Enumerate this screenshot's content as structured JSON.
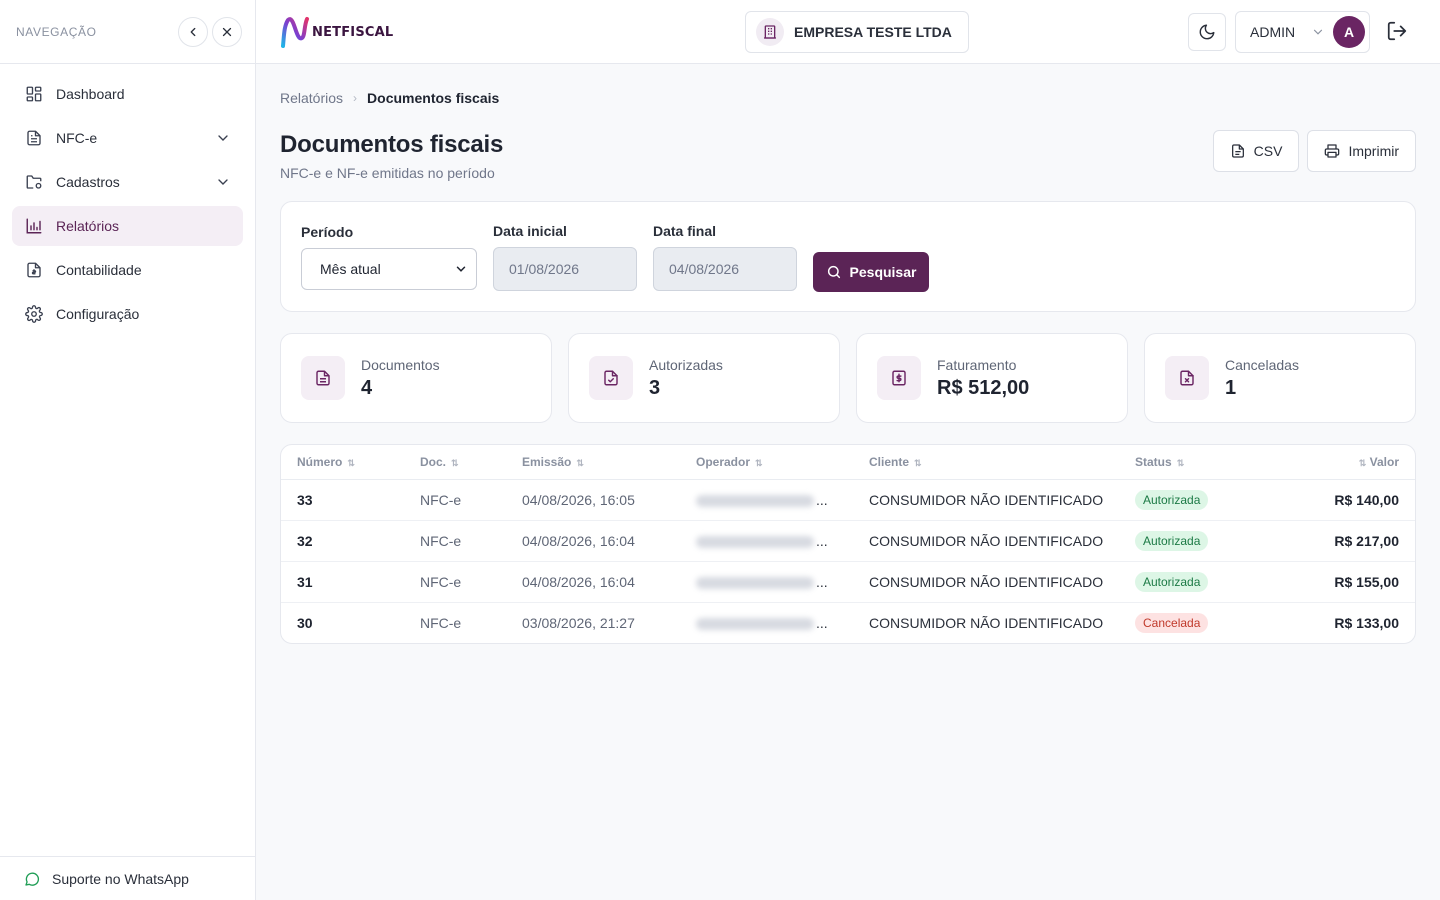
{
  "sidebar": {
    "title": "NAVEGAÇÃO",
    "items": [
      {
        "label": "Dashboard",
        "icon": "grid-icon",
        "active": false,
        "expandable": false
      },
      {
        "label": "NFC-e",
        "icon": "document-icon",
        "active": false,
        "expandable": true
      },
      {
        "label": "Cadastros",
        "icon": "folder-settings-icon",
        "active": false,
        "expandable": true
      },
      {
        "label": "Relatórios",
        "icon": "bar-chart-icon",
        "active": true,
        "expandable": false
      },
      {
        "label": "Contabilidade",
        "icon": "file-invoice-icon",
        "active": false,
        "expandable": false
      },
      {
        "label": "Configuração",
        "icon": "gear-icon",
        "active": false,
        "expandable": false
      }
    ],
    "footer": "Suporte no WhatsApp"
  },
  "header": {
    "logo_text": "NETFISCAL",
    "company": "EMPRESA TESTE LTDA",
    "user": "ADMIN",
    "avatar_letter": "A"
  },
  "breadcrumb": {
    "parent": "Relatórios",
    "current": "Documentos fiscais"
  },
  "page": {
    "title": "Documentos fiscais",
    "subtitle": "NFC-e e NF-e emitidas no período",
    "csv_label": "CSV",
    "print_label": "Imprimir"
  },
  "filters": {
    "period_label": "Período",
    "period_value": "Mês atual",
    "start_label": "Data inicial",
    "start_value": "01/08/2026",
    "end_label": "Data final",
    "end_value": "04/08/2026",
    "search_label": "Pesquisar"
  },
  "stats": [
    {
      "label": "Documentos",
      "value": "4",
      "icon": "document-icon"
    },
    {
      "label": "Autorizadas",
      "value": "3",
      "icon": "file-check-icon"
    },
    {
      "label": "Faturamento",
      "value": "R$ 512,00",
      "icon": "file-dollar-icon"
    },
    {
      "label": "Canceladas",
      "value": "1",
      "icon": "file-x-icon"
    }
  ],
  "table": {
    "columns": [
      "Número",
      "Doc.",
      "Emissão",
      "Operador",
      "Cliente",
      "Status",
      "Valor"
    ],
    "rows": [
      {
        "numero": "33",
        "doc": "NFC-e",
        "emissao": "04/08/2026, 16:05",
        "operador": "...",
        "cliente": "CONSUMIDOR NÃO IDENTIFICADO",
        "status": "Autorizada",
        "valor": "R$ 140,00"
      },
      {
        "numero": "32",
        "doc": "NFC-e",
        "emissao": "04/08/2026, 16:04",
        "operador": "...",
        "cliente": "CONSUMIDOR NÃO IDENTIFICADO",
        "status": "Autorizada",
        "valor": "R$ 217,00"
      },
      {
        "numero": "31",
        "doc": "NFC-e",
        "emissao": "04/08/2026, 16:04",
        "operador": "...",
        "cliente": "CONSUMIDOR NÃO IDENTIFICADO",
        "status": "Autorizada",
        "valor": "R$ 155,00"
      },
      {
        "numero": "30",
        "doc": "NFC-e",
        "emissao": "03/08/2026, 21:27",
        "operador": "...",
        "cliente": "CONSUMIDOR NÃO IDENTIFICADO",
        "status": "Cancelada",
        "valor": "R$ 133,00"
      }
    ]
  },
  "colors": {
    "brand": "#5b2456",
    "active_bg": "#f4eef5",
    "success_bg": "#ddf6e6",
    "success_text": "#1c7a45",
    "danger_bg": "#fde2e2",
    "danger_text": "#c0392b"
  }
}
